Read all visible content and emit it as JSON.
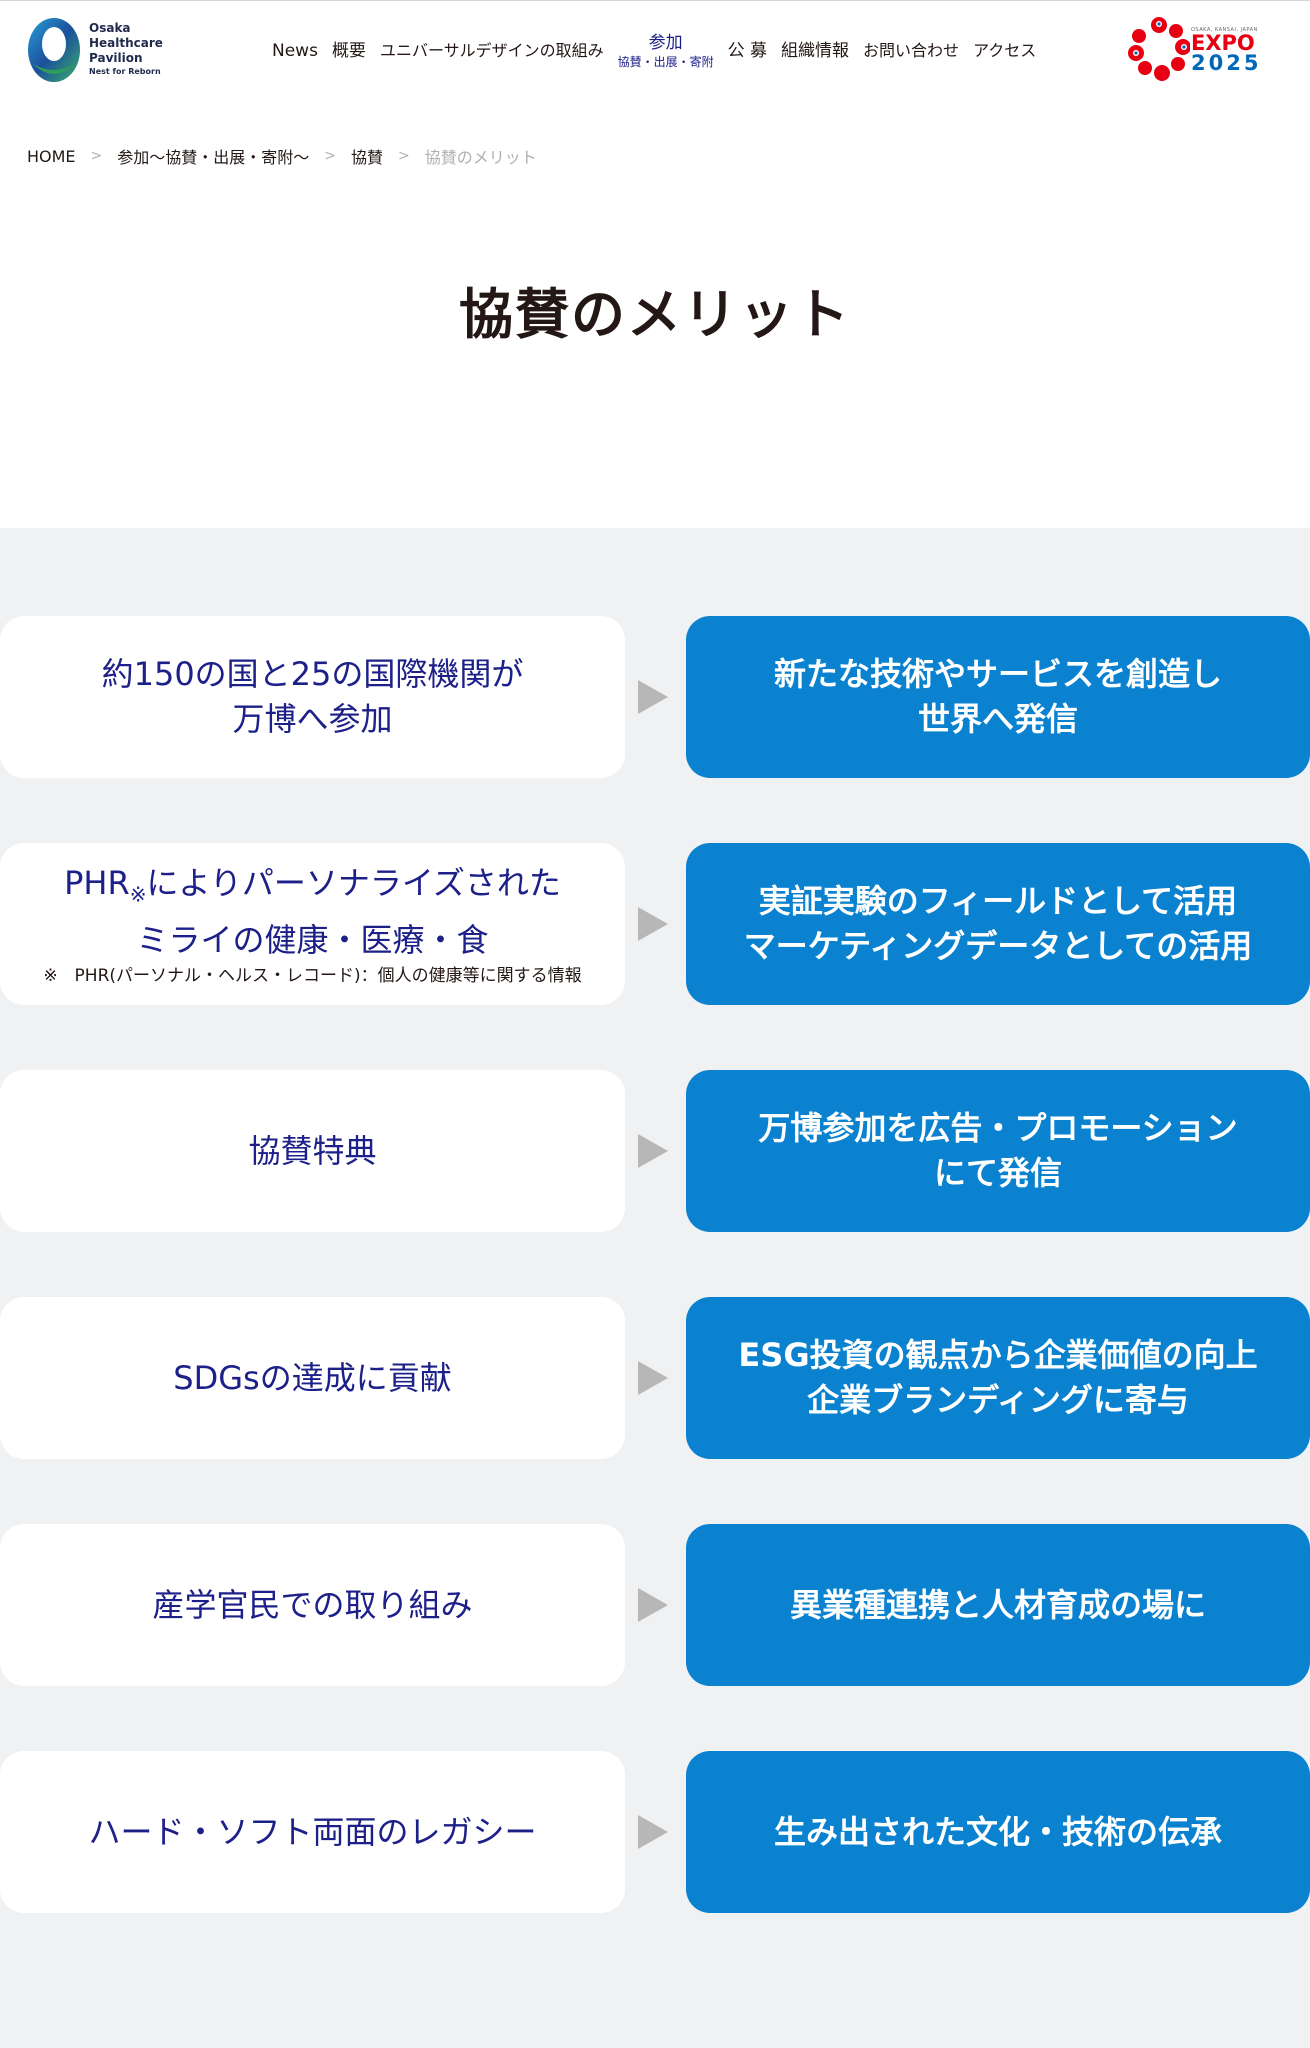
{
  "header": {
    "logo": {
      "lines": [
        "Osaka",
        "Healthcare",
        "Pavilion"
      ],
      "tagline": "Nest for Reborn"
    },
    "nav": [
      {
        "label": "News"
      },
      {
        "label": "概要"
      },
      {
        "label": "ユニバーサルデザインの取組み"
      },
      {
        "label": "参加",
        "sub": "協賛・出展・寄附",
        "active": true
      },
      {
        "label": "公 募"
      },
      {
        "label": "組織情報"
      },
      {
        "label": "お問い合わせ"
      },
      {
        "label": "アクセス"
      }
    ],
    "expo": {
      "small": "OSAKA, KANSAI, JAPAN",
      "word": "EXPO",
      "year": "2025"
    }
  },
  "breadcrumb": [
    {
      "label": "HOME"
    },
    {
      "label": "参加～協賛・出展・寄附～"
    },
    {
      "label": "協賛"
    },
    {
      "label": "協賛のメリット",
      "current": true
    }
  ],
  "page_title": "協賛のメリット",
  "merits": [
    {
      "left": "約150の国と25の国際機関が\n万博へ参加",
      "right": "新たな技術やサービスを創造し\n世界へ発信"
    },
    {
      "left_pre": "PHR",
      "left_mark": "※",
      "left_post": "によりパーソナライズされた",
      "left_line2": "ミライの健康・医療・食",
      "note": "※　PHR(パーソナル・ヘルス・レコード)：個人の健康等に関する情報",
      "right": "実証実験のフィールドとして活用\nマーケティングデータとしての活用"
    },
    {
      "left": "協賛特典",
      "right": "万博参加を広告・プロモーション\nにて発信"
    },
    {
      "left": "SDGsの達成に貢献",
      "right": "ESG投資の観点から企業価値の向上\n企業ブランディングに寄与"
    },
    {
      "left": "産学官民での取り組み",
      "right": "異業種連携と人材育成の場に"
    },
    {
      "left": "ハード・ソフト両面のレガシー",
      "right": "生み出された文化・技術の伝承"
    }
  ],
  "colors": {
    "navy_text": "#1d2088",
    "merit_blue": "#0a82d0",
    "section_bg": "#f0f1f3",
    "arrow_gray": "#b7b7b7"
  }
}
